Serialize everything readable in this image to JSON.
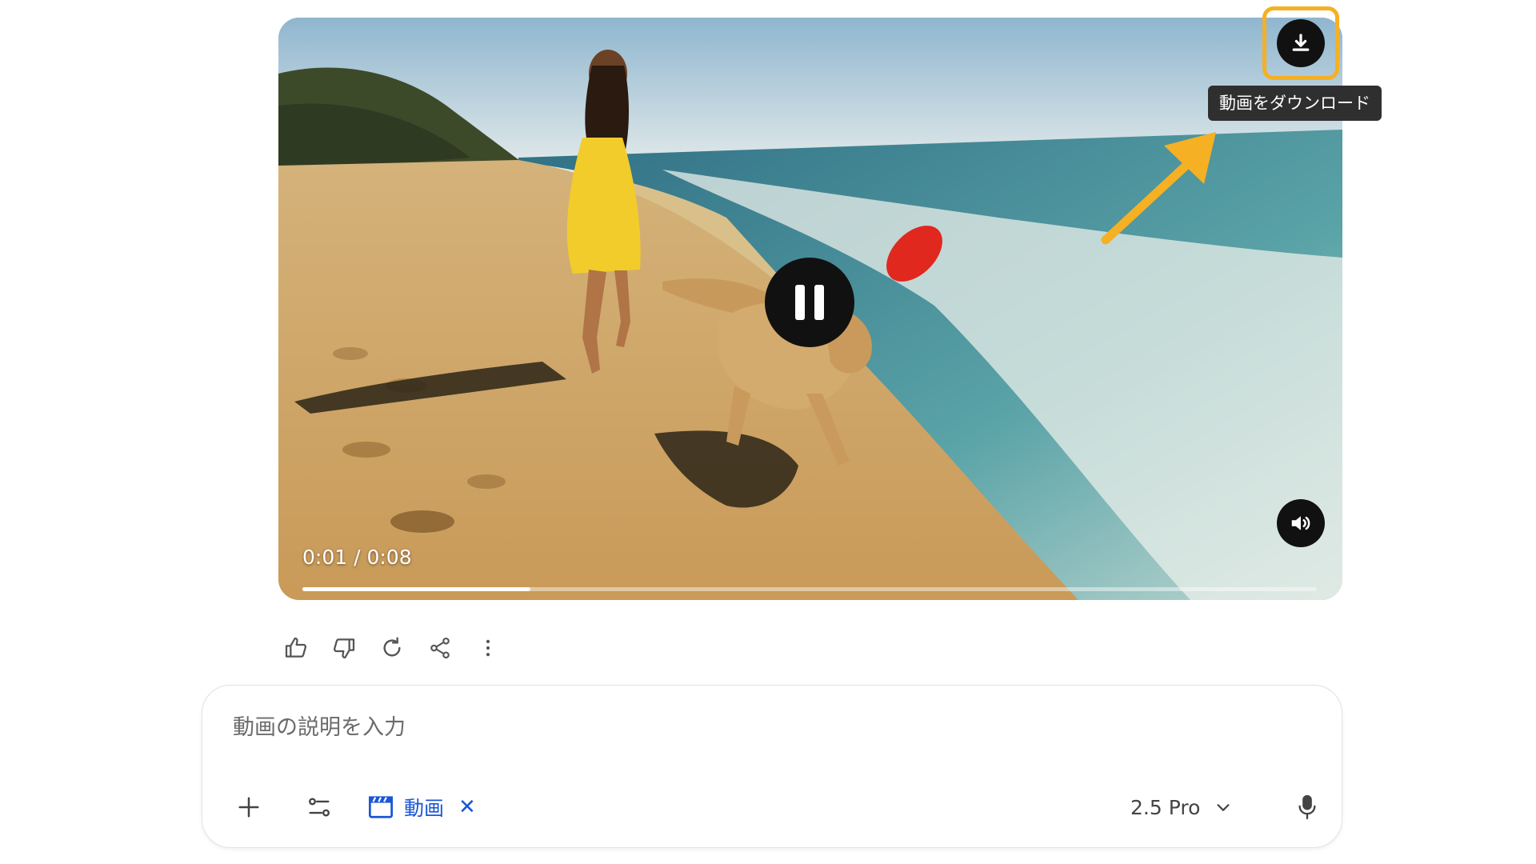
{
  "video": {
    "time_display": "0:01 / 0:08",
    "progress": 0.225
  },
  "download": {
    "tooltip": "動画をダウンロード"
  },
  "prompt": {
    "placeholder": "動画の説明を入力",
    "chip_label": "動画",
    "chip_close": "✕",
    "model_label": "2.5 Pro"
  },
  "colors": {
    "highlight": "#f5b023",
    "chip_blue": "#1a56d6",
    "button_dark": "#111111"
  },
  "icons": {
    "download": "download-icon",
    "pause": "pause-icon",
    "volume": "volume-icon",
    "thumbs_up": "thumbs-up-icon",
    "thumbs_down": "thumbs-down-icon",
    "regenerate": "refresh-icon",
    "share": "share-icon",
    "more": "more-vert-icon",
    "add": "plus-icon",
    "tools": "tune-icon",
    "video": "clapperboard-icon",
    "chevron": "chevron-down-icon",
    "mic": "mic-icon"
  }
}
